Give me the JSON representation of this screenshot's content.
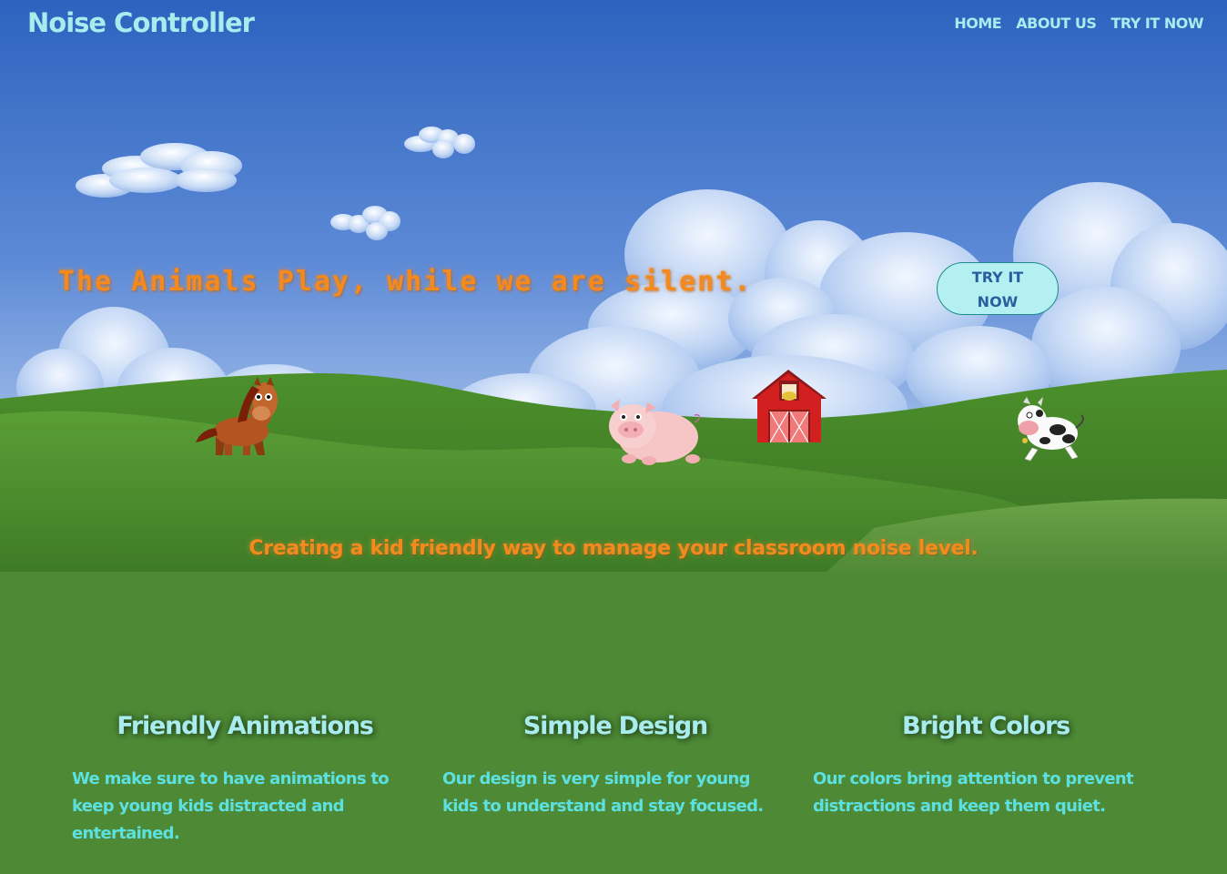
{
  "header": {
    "brand": "Noise Controller",
    "nav": [
      {
        "label": "HOME"
      },
      {
        "label": "ABOUT US"
      },
      {
        "label": "TRY IT NOW"
      }
    ]
  },
  "hero": {
    "tagline": "The Animals Play, while we are silent.",
    "cta_label": "TRY IT NOW",
    "subtagline": "Creating a kid friendly way to manage your classroom noise level."
  },
  "features": [
    {
      "title": "Friendly Animations",
      "text": "We make sure to have animations to keep young kids distracted and entertained."
    },
    {
      "title": "Simple Design",
      "text": "Our design is very simple for young kids to understand and stay focused."
    },
    {
      "title": "Bright Colors",
      "text": "Our colors bring attention to prevent distractions and keep them quiet."
    }
  ],
  "colors": {
    "sky_top": "#2f64c0",
    "grass": "#4e8a35",
    "accent_orange": "#f48a1e",
    "accent_cyan": "#a9ecee"
  }
}
